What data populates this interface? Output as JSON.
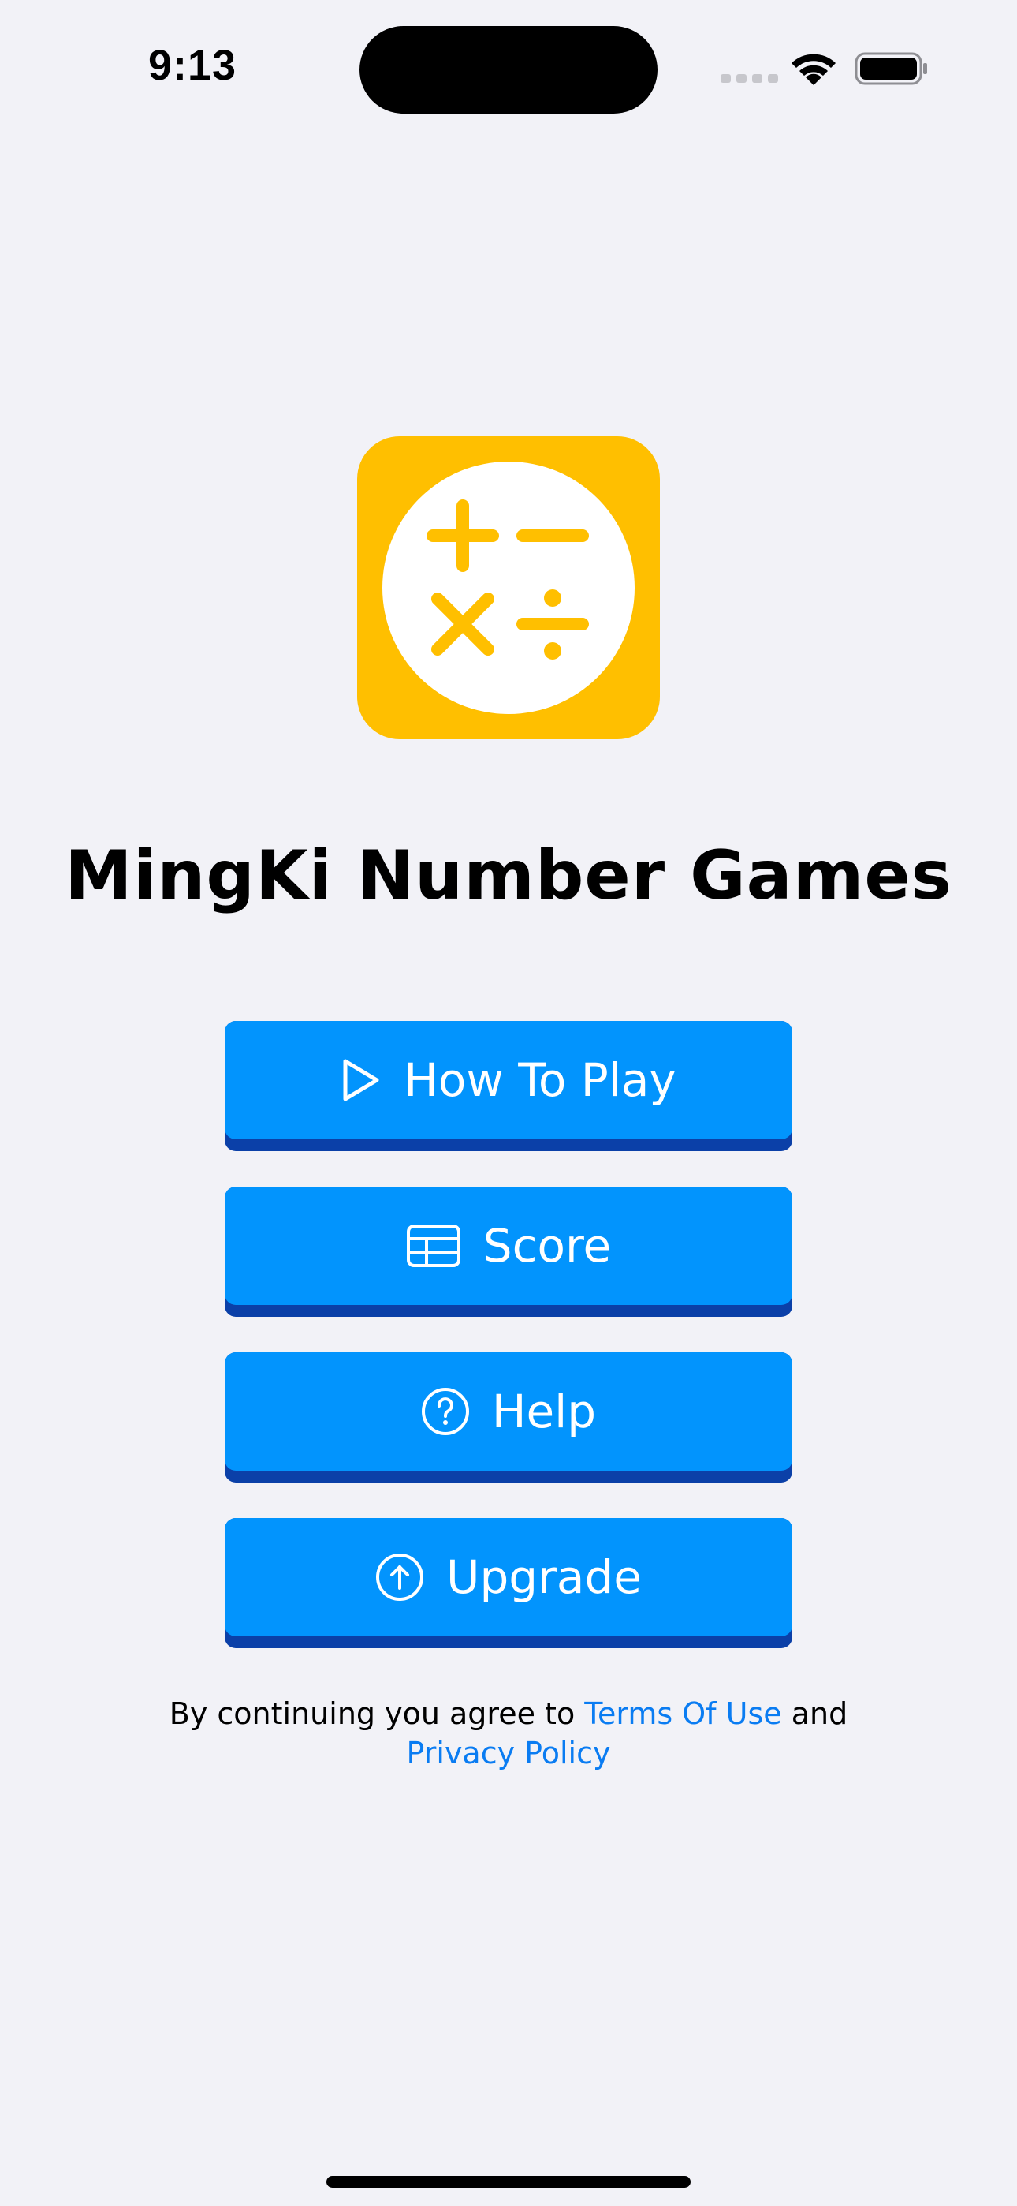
{
  "status_bar": {
    "time": "9:13"
  },
  "app": {
    "title": "MingKi Number Games"
  },
  "menu": {
    "how_to_play": {
      "label": "How To Play",
      "icon": "play-icon"
    },
    "score": {
      "label": "Score",
      "icon": "table-icon"
    },
    "help": {
      "label": "Help",
      "icon": "question-circle-icon"
    },
    "upgrade": {
      "label": "Upgrade",
      "icon": "arrow-up-circle-icon"
    }
  },
  "footer": {
    "prefix": "By continuing you agree to ",
    "terms_link": "Terms Of Use",
    "middle": " and",
    "privacy_link": "Privacy Policy"
  },
  "colors": {
    "background": "#f2f2f7",
    "button": "#0294fd",
    "button_shadow": "#0b40a8",
    "logo": "#ffbf00",
    "link": "#0a7cf2"
  }
}
